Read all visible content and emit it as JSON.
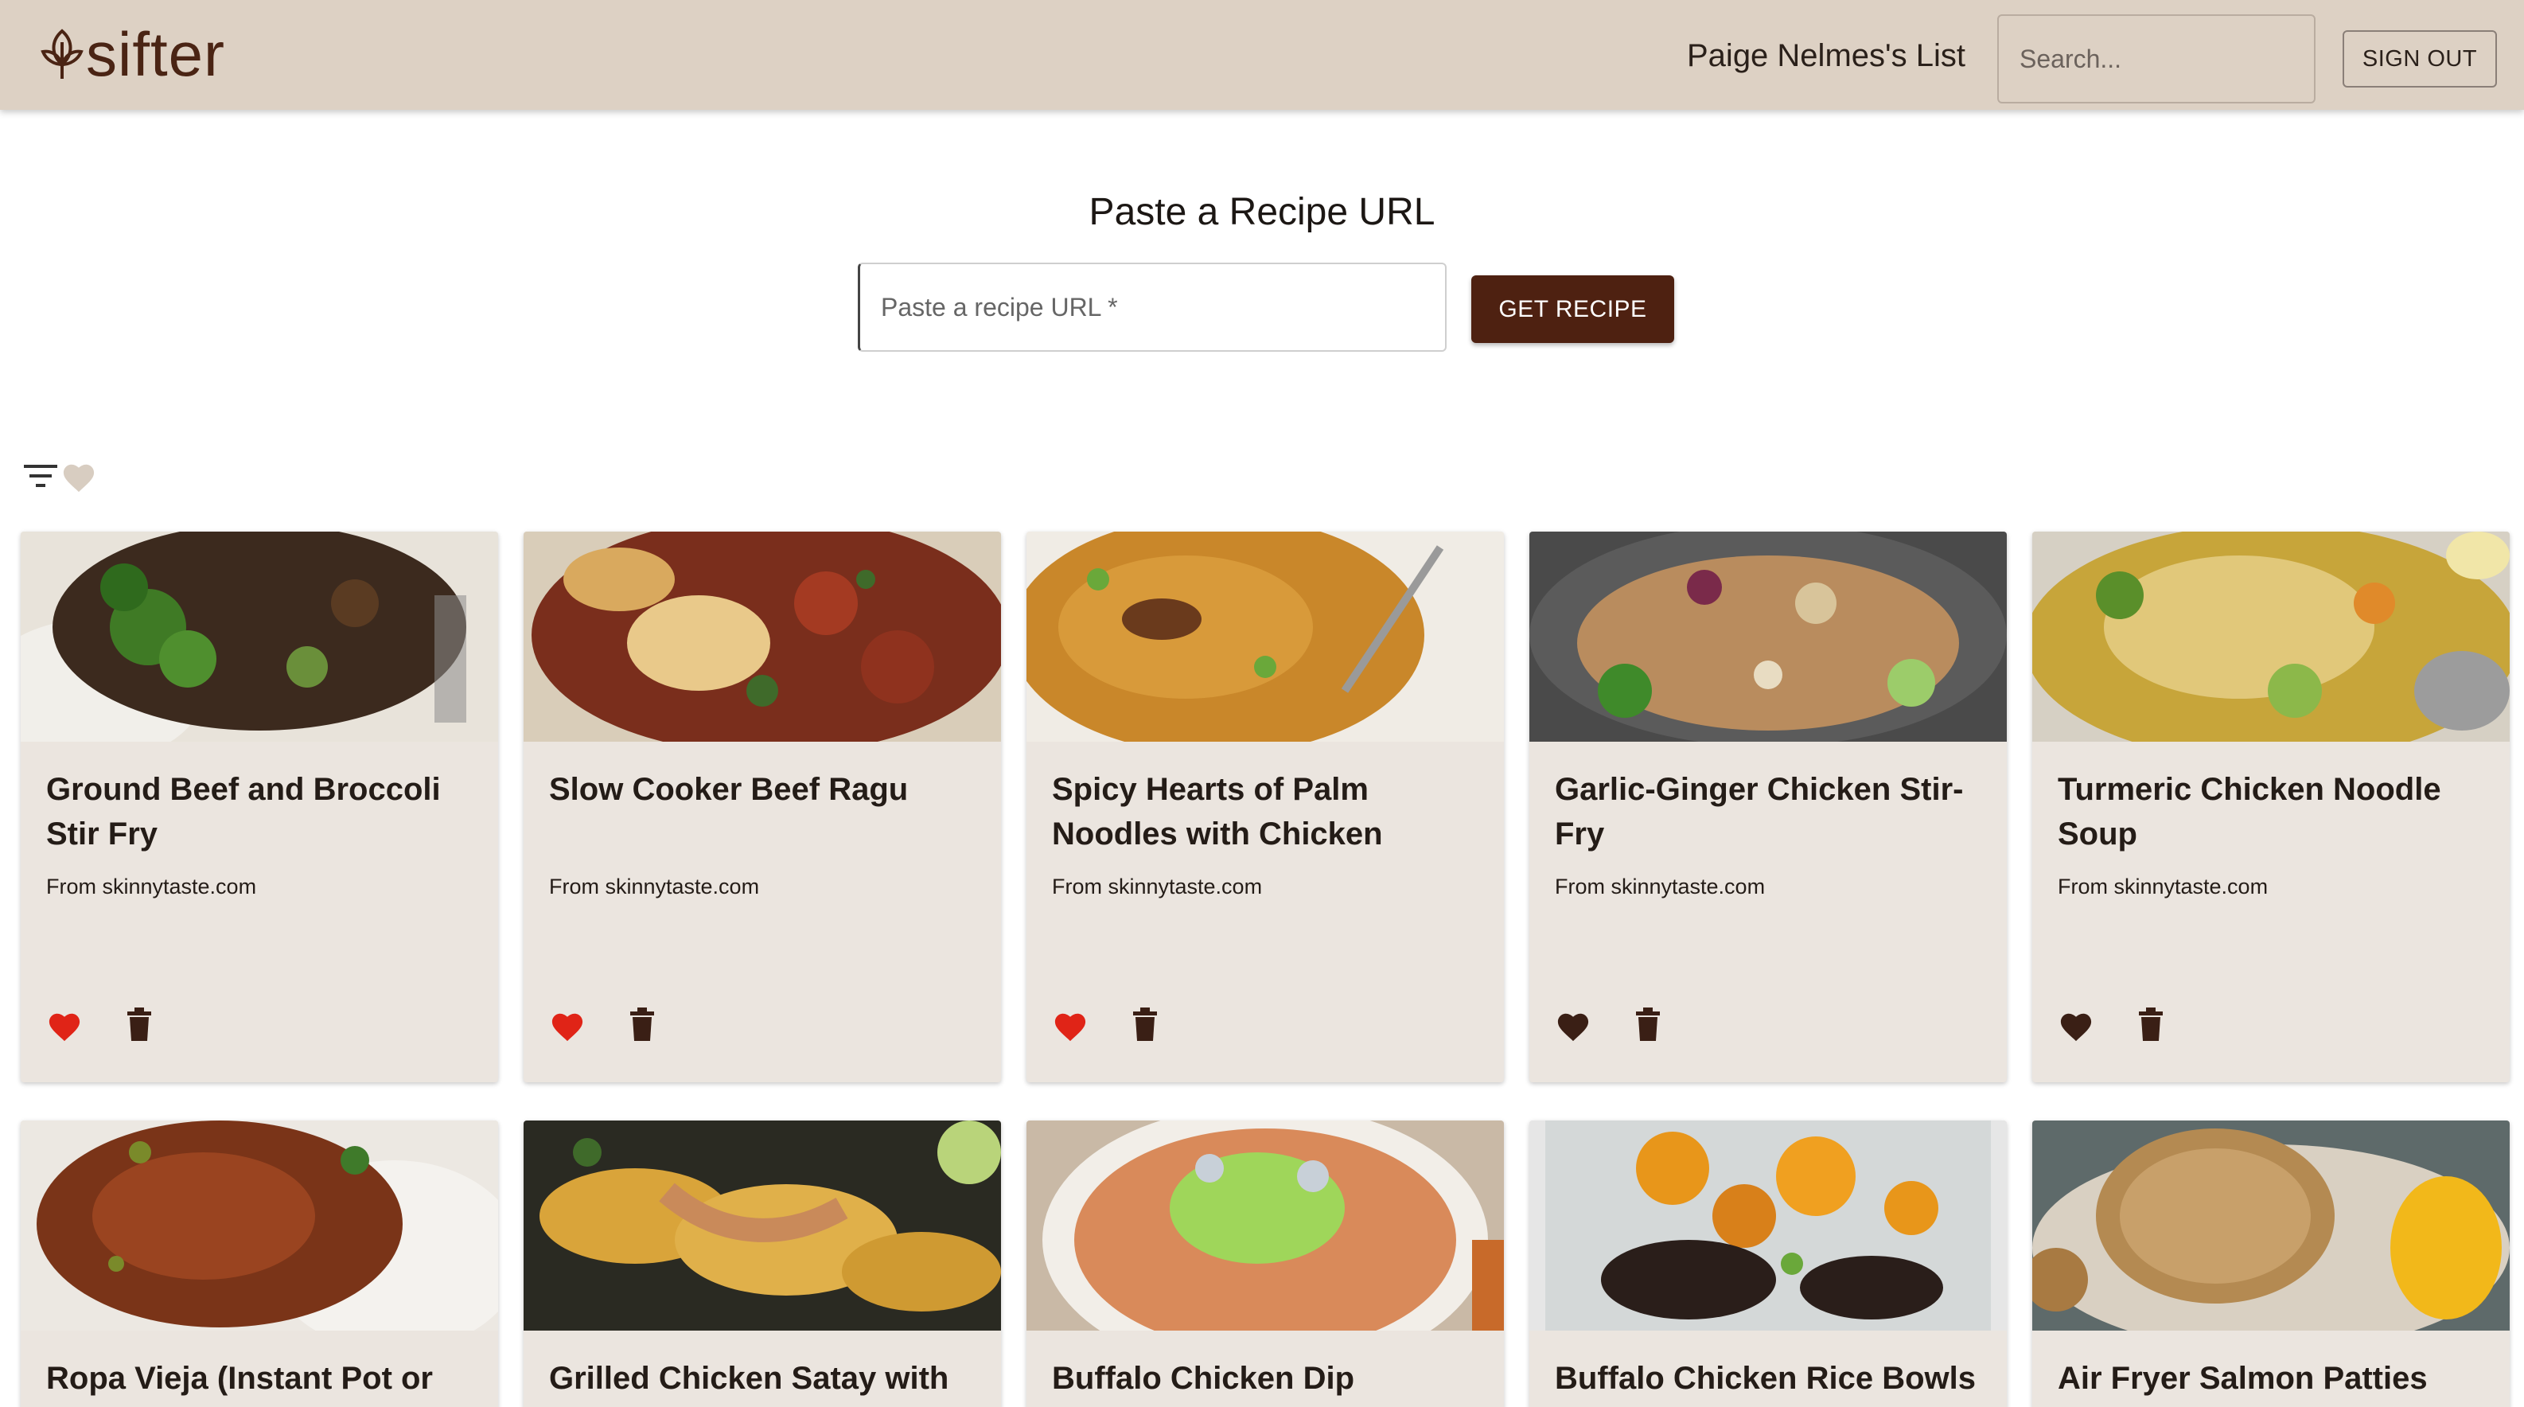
{
  "header": {
    "logo_text": "sifter",
    "list_title": "Paige Nelmes's List",
    "search_placeholder": "Search...",
    "sign_out_label": "SIGN OUT"
  },
  "url_section": {
    "title": "Paste a Recipe URL",
    "input_placeholder": "Paste a recipe URL *",
    "get_recipe_label": "GET RECIPE"
  },
  "filters": {
    "filter_icon": "filter-list-icon",
    "favorite_filter_icon": "heart-icon"
  },
  "colors": {
    "header_bg": "#ddd1c4",
    "brand_brown": "#4e2111",
    "card_bg": "#ebe5df",
    "favorite_red": "#e02417",
    "icon_dark": "#3a1f15"
  },
  "recipes": [
    {
      "title": "Ground Beef and Broccoli Stir Fry",
      "source": "From skinnytaste.com",
      "favorite": true
    },
    {
      "title": "Slow Cooker Beef Ragu",
      "source": "From skinnytaste.com",
      "favorite": true
    },
    {
      "title": "Spicy Hearts of Palm Noodles with Chicken",
      "source": "From skinnytaste.com",
      "favorite": true
    },
    {
      "title": "Garlic-Ginger Chicken Stir-Fry",
      "source": "From skinnytaste.com",
      "favorite": false
    },
    {
      "title": "Turmeric Chicken Noodle Soup",
      "source": "From skinnytaste.com",
      "favorite": false
    },
    {
      "title": "Ropa Vieja (Instant Pot or",
      "source": "",
      "favorite": null
    },
    {
      "title": "Grilled Chicken Satay with",
      "source": "",
      "favorite": null
    },
    {
      "title": "Buffalo Chicken Dip",
      "source": "",
      "favorite": null
    },
    {
      "title": "Buffalo Chicken Rice Bowls",
      "source": "",
      "favorite": null
    },
    {
      "title": "Air Fryer Salmon Patties",
      "source": "",
      "favorite": null
    }
  ]
}
